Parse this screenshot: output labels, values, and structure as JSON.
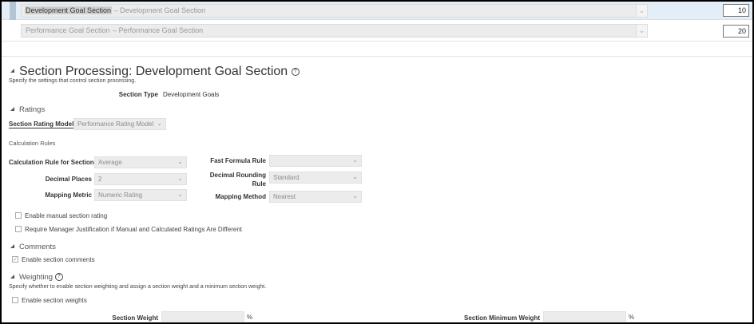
{
  "goal_sections": [
    {
      "name": "Development Goal Section",
      "description": "Development Goal Section",
      "separator": "–",
      "sequence": "10"
    },
    {
      "name": "Performance Goal Section",
      "description": "Performance Goal Section",
      "separator": "–",
      "sequence": "20"
    }
  ],
  "section_processing": {
    "title": "Section Processing: Development Goal Section",
    "help_glyph": "?",
    "description": "Specify the settings that control section processing.",
    "section_type_label": "Section Type",
    "section_type_value": "Development Goals"
  },
  "ratings": {
    "title": "Ratings",
    "model_label": "Section Rating Model",
    "model_value": "Performance Rating Model"
  },
  "calc": {
    "title": "Calculation Rules",
    "rule_label": "Calculation Rule for Section",
    "rule_value": "Average",
    "decimal_places_label": "Decimal Places",
    "decimal_places_value": "2",
    "mapping_metric_label": "Mapping Metric",
    "mapping_metric_value": "Numeric Rating",
    "fast_formula_label": "Fast Formula Rule",
    "fast_formula_value": "",
    "rounding_label_1": "Decimal Rounding",
    "rounding_label_2": "Rule",
    "rounding_value": "Standard",
    "mapping_method_label": "Mapping Method",
    "mapping_method_value": "Nearest",
    "manual_rating_label": "Enable manual section rating",
    "justification_label": "Require Manager Justification if Manual and Calculated Ratings Are Different"
  },
  "comments": {
    "title": "Comments",
    "enable_label": "Enable section comments",
    "check_glyph": "✓"
  },
  "weighting": {
    "title": "Weighting",
    "description": "Specify whether to enable section weighting and assign a section weight and a minimum section weight.",
    "enable_label": "Enable section weights",
    "weight_label": "Section Weight",
    "min_weight_label": "Section Minimum Weight",
    "pct": "%"
  },
  "glyphs": {
    "chevron": "⌄"
  }
}
